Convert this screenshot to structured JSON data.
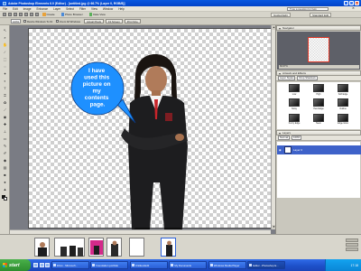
{
  "window": {
    "title": "Adobe Photoshop Elements 6.0 (Editor) - [untitled.jpg @ 66.7% (Layer 0, RGB/8)]",
    "controls": [
      "_",
      "□",
      "✕"
    ]
  },
  "menu": {
    "items": [
      "File",
      "Edit",
      "Image",
      "Enhance",
      "Layer",
      "Select",
      "Filter",
      "View",
      "Window",
      "Help"
    ],
    "help_search_placeholder": "Type a question for help",
    "close_doc": "✕"
  },
  "toolbar": {
    "create_label": "Create",
    "organizer_label": "Photo Browser",
    "fullscreen_label": "Date View",
    "guided_fix_label": "Guided Edit",
    "standard_edit_label": "Standard Edit"
  },
  "options_bar": {
    "zoom_value": "100%",
    "resize_windows_label": "Resize Windows To Fit",
    "zoom_all_label": "Zoom All Windows",
    "actual_pixels_label": "Actual Pixels",
    "fit_screen_label": "Fit Screen",
    "print_size_label": "Print Size"
  },
  "canvas": {
    "callout_lines": [
      "I have",
      "used this",
      "picture on",
      "my",
      "contents",
      "page."
    ],
    "callout_fill": "#1e90ff"
  },
  "palettes": {
    "navigator": {
      "title": "Navigator",
      "zoom_label": "66.67%"
    },
    "effects": {
      "title": "Artwork and Effects",
      "category": "Layer Styles",
      "filter": "Drop Shadows",
      "items": [
        "Low",
        "High",
        "Soft Edge",
        "Noisy",
        "Hard Edge",
        "Outline",
        "Fuzzy Edge",
        "Neon",
        "Edge Glow"
      ]
    },
    "layers": {
      "title": "Layers",
      "mode": "Normal",
      "opacity": "100%",
      "layer_name": "Layer 0"
    }
  },
  "taskbar": {
    "start_label": "start",
    "tasks": [
      "Inbox - Microsoft...",
      "Foundation portfolio",
      "Untitled-Edit",
      "My Documents",
      "Windows Media Player",
      "Editor - Photoshop E..."
    ],
    "clock": "17:18"
  }
}
